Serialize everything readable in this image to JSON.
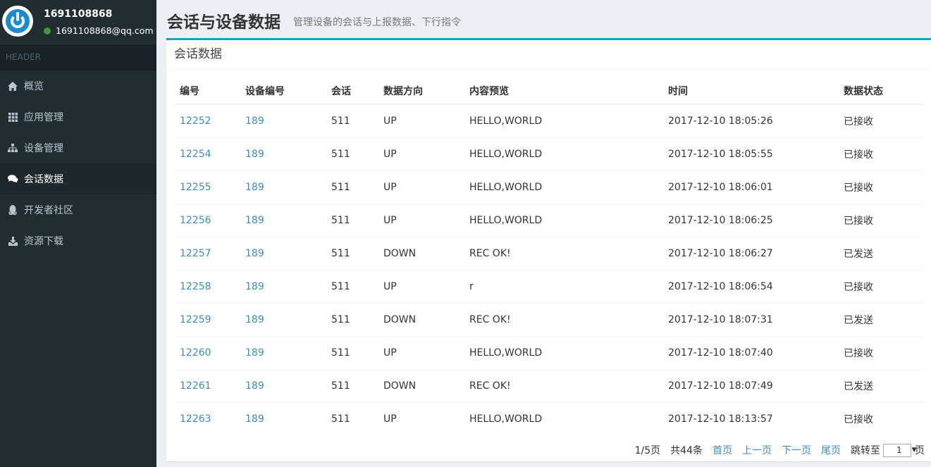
{
  "user": {
    "name": "1691108868",
    "email": "1691108868@qq.com"
  },
  "sidebar": {
    "header": "HEADER",
    "items": [
      {
        "label": "概览",
        "icon": "home-icon"
      },
      {
        "label": "应用管理",
        "icon": "grid-icon"
      },
      {
        "label": "设备管理",
        "icon": "sitemap-icon"
      },
      {
        "label": "会话数据",
        "icon": "comments-icon",
        "active": true
      },
      {
        "label": "开发者社区",
        "icon": "qq-icon"
      },
      {
        "label": "资源下载",
        "icon": "download-icon"
      }
    ]
  },
  "page": {
    "title": "会话与设备数据",
    "subtitle": "管理设备的会话与上报数据、下行指令"
  },
  "box": {
    "title": "会话数据"
  },
  "table": {
    "headers": [
      "编号",
      "设备编号",
      "会话",
      "数据方向",
      "内容预览",
      "时间",
      "数据状态"
    ],
    "rows": [
      [
        "12252",
        "189",
        "511",
        "UP",
        "HELLO,WORLD",
        "2017-12-10 18:05:26",
        "已接收"
      ],
      [
        "12254",
        "189",
        "511",
        "UP",
        "HELLO,WORLD",
        "2017-12-10 18:05:55",
        "已接收"
      ],
      [
        "12255",
        "189",
        "511",
        "UP",
        "HELLO,WORLD",
        "2017-12-10 18:06:01",
        "已接收"
      ],
      [
        "12256",
        "189",
        "511",
        "UP",
        "HELLO,WORLD",
        "2017-12-10 18:06:25",
        "已接收"
      ],
      [
        "12257",
        "189",
        "511",
        "DOWN",
        "REC OK!",
        "2017-12-10 18:06:27",
        "已发送"
      ],
      [
        "12258",
        "189",
        "511",
        "UP",
        "r",
        "2017-12-10 18:06:54",
        "已接收"
      ],
      [
        "12259",
        "189",
        "511",
        "DOWN",
        "REC OK!",
        "2017-12-10 18:07:31",
        "已发送"
      ],
      [
        "12260",
        "189",
        "511",
        "UP",
        "HELLO,WORLD",
        "2017-12-10 18:07:40",
        "已接收"
      ],
      [
        "12261",
        "189",
        "511",
        "DOWN",
        "REC OK!",
        "2017-12-10 18:07:49",
        "已发送"
      ],
      [
        "12263",
        "189",
        "511",
        "UP",
        "HELLO,WORLD",
        "2017-12-10 18:13:57",
        "已接收"
      ]
    ]
  },
  "pager": {
    "page_info": "1/5页",
    "total": "共44条",
    "first": "首页",
    "prev": "上一页",
    "next": "下一页",
    "last": "尾页",
    "jump_label": "跳转至",
    "jump_value": "1",
    "page_unit": "页"
  },
  "colors": {
    "sidebar": "#222d32",
    "accent": "#00a7d0",
    "link": "#3c8dbc",
    "online": "#3c9a3c"
  }
}
